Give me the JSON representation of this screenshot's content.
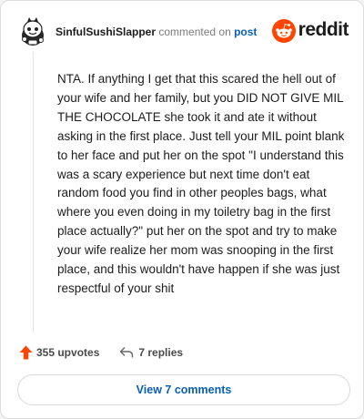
{
  "header": {
    "username": "SinfulSushiSlapper",
    "action_text": "commented on",
    "post_link": "post"
  },
  "logo": {
    "text": "reddit",
    "icon": "reddit-snoo-icon",
    "accent": "#ff4500"
  },
  "comment": {
    "body": "NTA. If anything I get that this scared the hell out of your wife and her family, but you DID NOT GIVE MIL THE CHOCOLATE she took it and ate it without asking in the first place. Just tell your MIL point blank to her face and put her on the spot \"I understand this was a scary experience but next time don't eat random food you find in other peoples bags, what where you even doing in my toiletry bag in the first place actually?\" put her on the spot and try to make your wife realize her mom was snooping in the first place, and this wouldn't have happen if she was just respectful of your shit"
  },
  "footer": {
    "upvotes": "355 upvotes",
    "upvote_icon": "upvote-arrow-icon",
    "replies": "7 replies",
    "reply_icon": "reply-arrow-icon"
  },
  "view_button": {
    "label": "View 7 comments"
  },
  "colors": {
    "upvote": "#ff4500",
    "link": "#0a5fb0",
    "border": "#dcdcdc"
  }
}
